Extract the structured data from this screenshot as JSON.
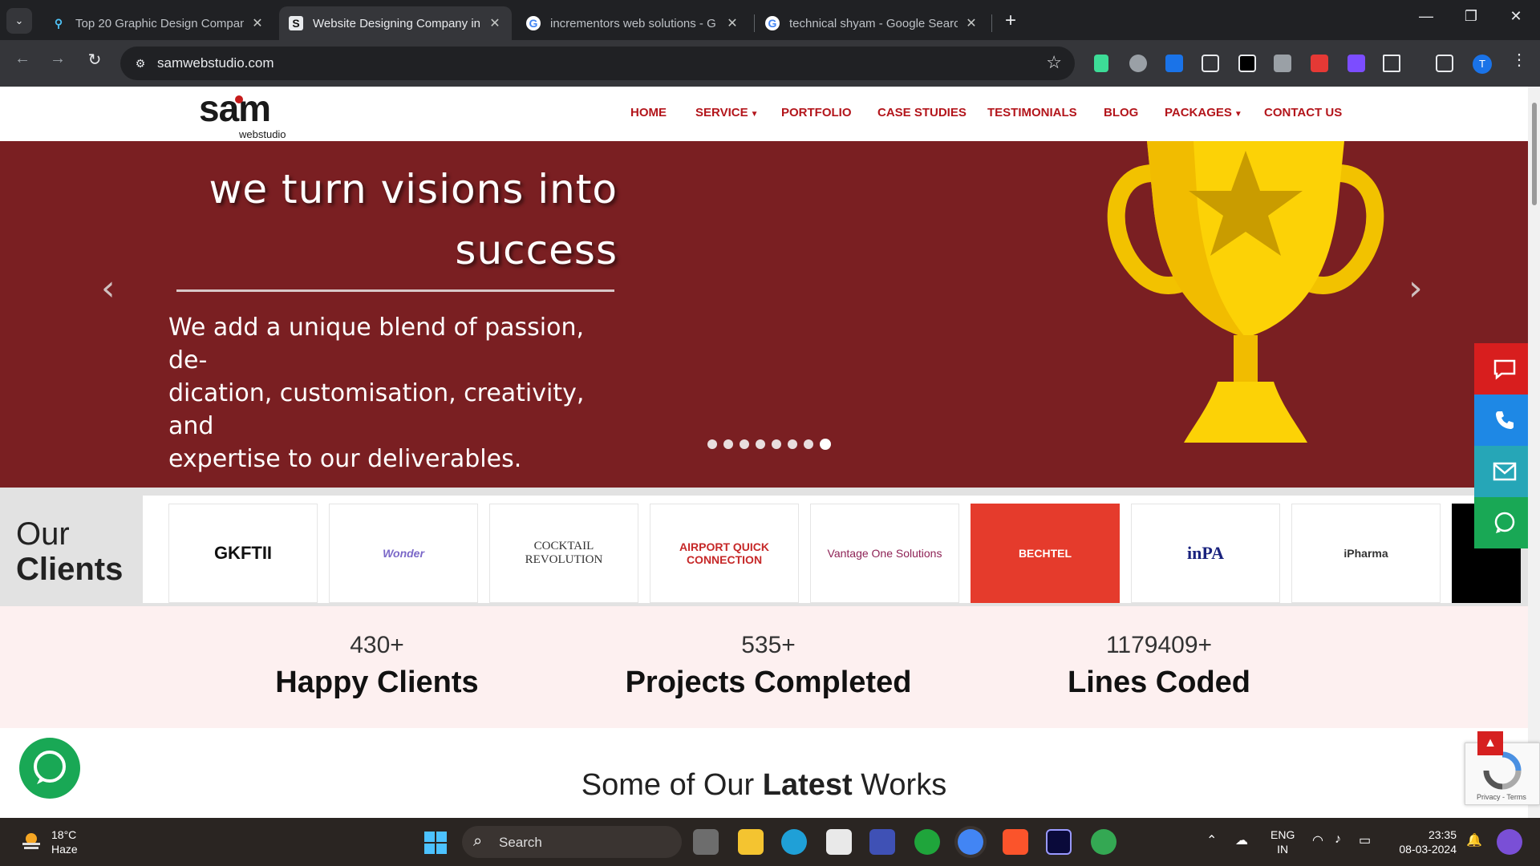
{
  "browser": {
    "tabs": [
      {
        "title": "Top 20 Graphic Design Compan",
        "active": false
      },
      {
        "title": "Website Designing Company in",
        "active": true
      },
      {
        "title": "incrementors web solutions - G",
        "active": false
      },
      {
        "title": "technical shyam - Google Searc",
        "active": false
      }
    ],
    "url": "samwebstudio.com",
    "profile_initial": "T"
  },
  "site": {
    "logo_main": "sam",
    "logo_sub": "webstudio",
    "nav": [
      "HOME",
      "SERVICE",
      "PORTFOLIO",
      "CASE STUDIES",
      "TESTIMONIALS",
      "BLOG",
      "PACKAGES",
      "CONTACT US"
    ],
    "hero": {
      "title_line1": "we turn visions into",
      "title_line2": "success",
      "text_line1": "We add a unique blend of passion, de-",
      "text_line2": "dication, customisation, creativity, and",
      "text_line3": "expertise to our deliverables.",
      "slide_count": 8,
      "active_slide": 8
    },
    "clients": {
      "label_line1": "Our",
      "label_line2": "Clients",
      "logos": [
        "GKFTII",
        "Wonder",
        "COCKTAIL REVOLUTION",
        "AIRPORT QUICK CONNECTION",
        "Vantage One Solutions",
        "BECHTEL",
        "inPA",
        "iPharma"
      ]
    },
    "stats": [
      {
        "number": "430+",
        "label": "Happy Clients"
      },
      {
        "number": "535+",
        "label": "Projects Completed"
      },
      {
        "number": "1179409+",
        "label": "Lines Coded"
      }
    ],
    "latest": {
      "pre": "Some of Our ",
      "bold": "Latest",
      "post": " Works"
    },
    "recaptcha_text": "Privacy - Terms",
    "colors": {
      "brand_red": "#b3151b",
      "hero_bg": "#7a1f22",
      "whatsapp": "#19a855",
      "phone_blue": "#1e88e5",
      "email_teal": "#26a6b7"
    }
  },
  "taskbar": {
    "weather_temp": "18°C",
    "weather_desc": "Haze",
    "search_placeholder": "Search",
    "lang_line1": "ENG",
    "lang_line2": "IN",
    "time": "23:35",
    "date": "08-03-2024"
  }
}
